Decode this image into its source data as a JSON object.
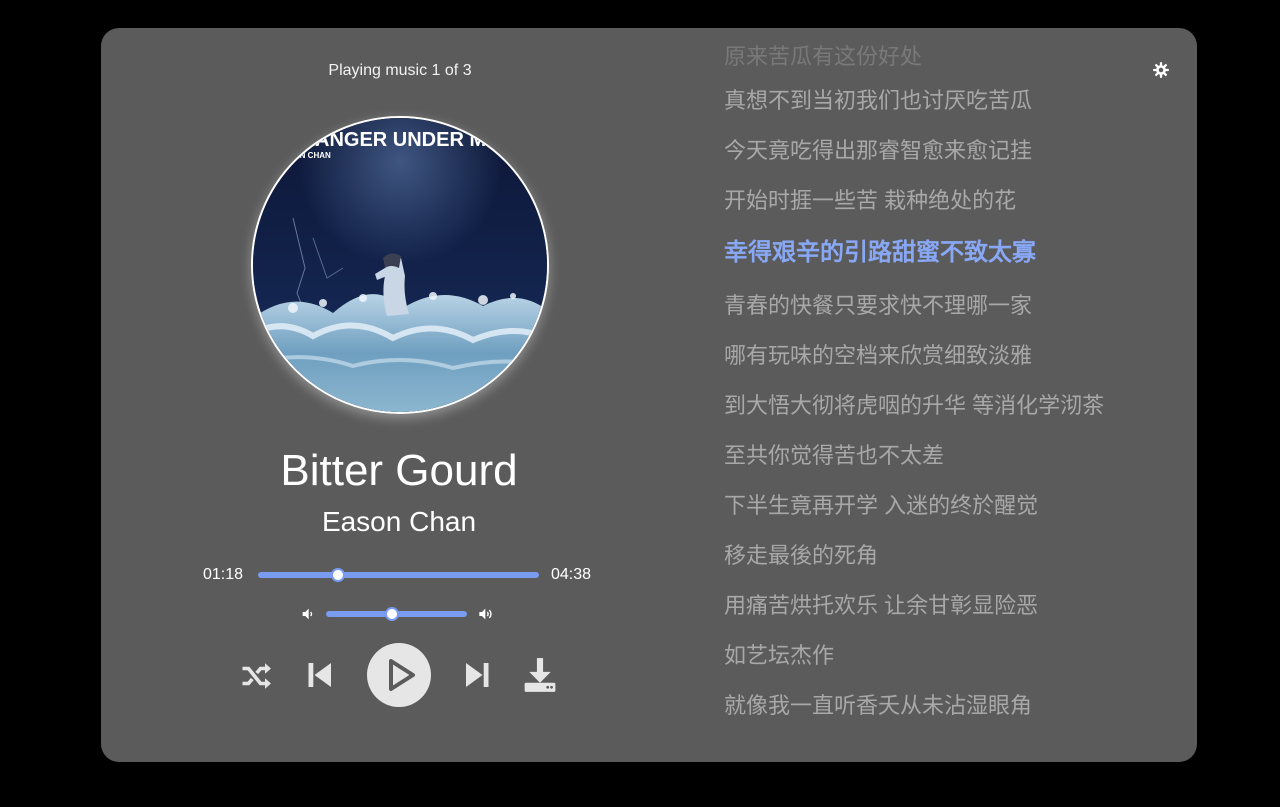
{
  "status": "Playing music 1 of 3",
  "song": {
    "title": "Bitter Gourd",
    "artist": "Eason Chan",
    "cover_text": "STRANGER UNDER MY SKIN",
    "cover_subtext": "EASON CHAN"
  },
  "playback": {
    "elapsed": "01:18",
    "duration": "04:38",
    "progress": 0.285,
    "volume": 0.47
  },
  "controls": {
    "shuffle_icon": "shuffle-icon",
    "previous_icon": "skip-previous-icon",
    "play_icon": "play-icon",
    "next_icon": "skip-next-icon",
    "download_icon": "download-icon",
    "settings_icon": "gear-icon",
    "volume_low_icon": "volume-low-icon",
    "volume_high_icon": "volume-high-icon"
  },
  "colors": {
    "accent": "#7a9cf0",
    "active_lyric": "#88a8f5",
    "panel": "#5b5b5c"
  },
  "lyrics": {
    "active_index": 4,
    "lines": [
      "原来苦瓜有这份好处",
      "真想不到当初我们也讨厌吃苦瓜",
      "今天竟吃得出那睿智愈来愈记挂",
      "开始时捱一些苦 栽种绝处的花",
      "幸得艰辛的引路甜蜜不致太寡",
      "青春的快餐只要求快不理哪一家",
      "哪有玩味的空档来欣赏细致淡雅",
      "到大悟大彻将虎咽的升华 等消化学沏茶",
      "至共你觉得苦也不太差",
      "下半生竟再开学 入迷的终於醒觉",
      "移走最後的死角",
      "用痛苦烘托欢乐 让余甘彰显险恶",
      "如艺坛杰作",
      "就像我一直听香夭从未沾湿眼角"
    ]
  }
}
